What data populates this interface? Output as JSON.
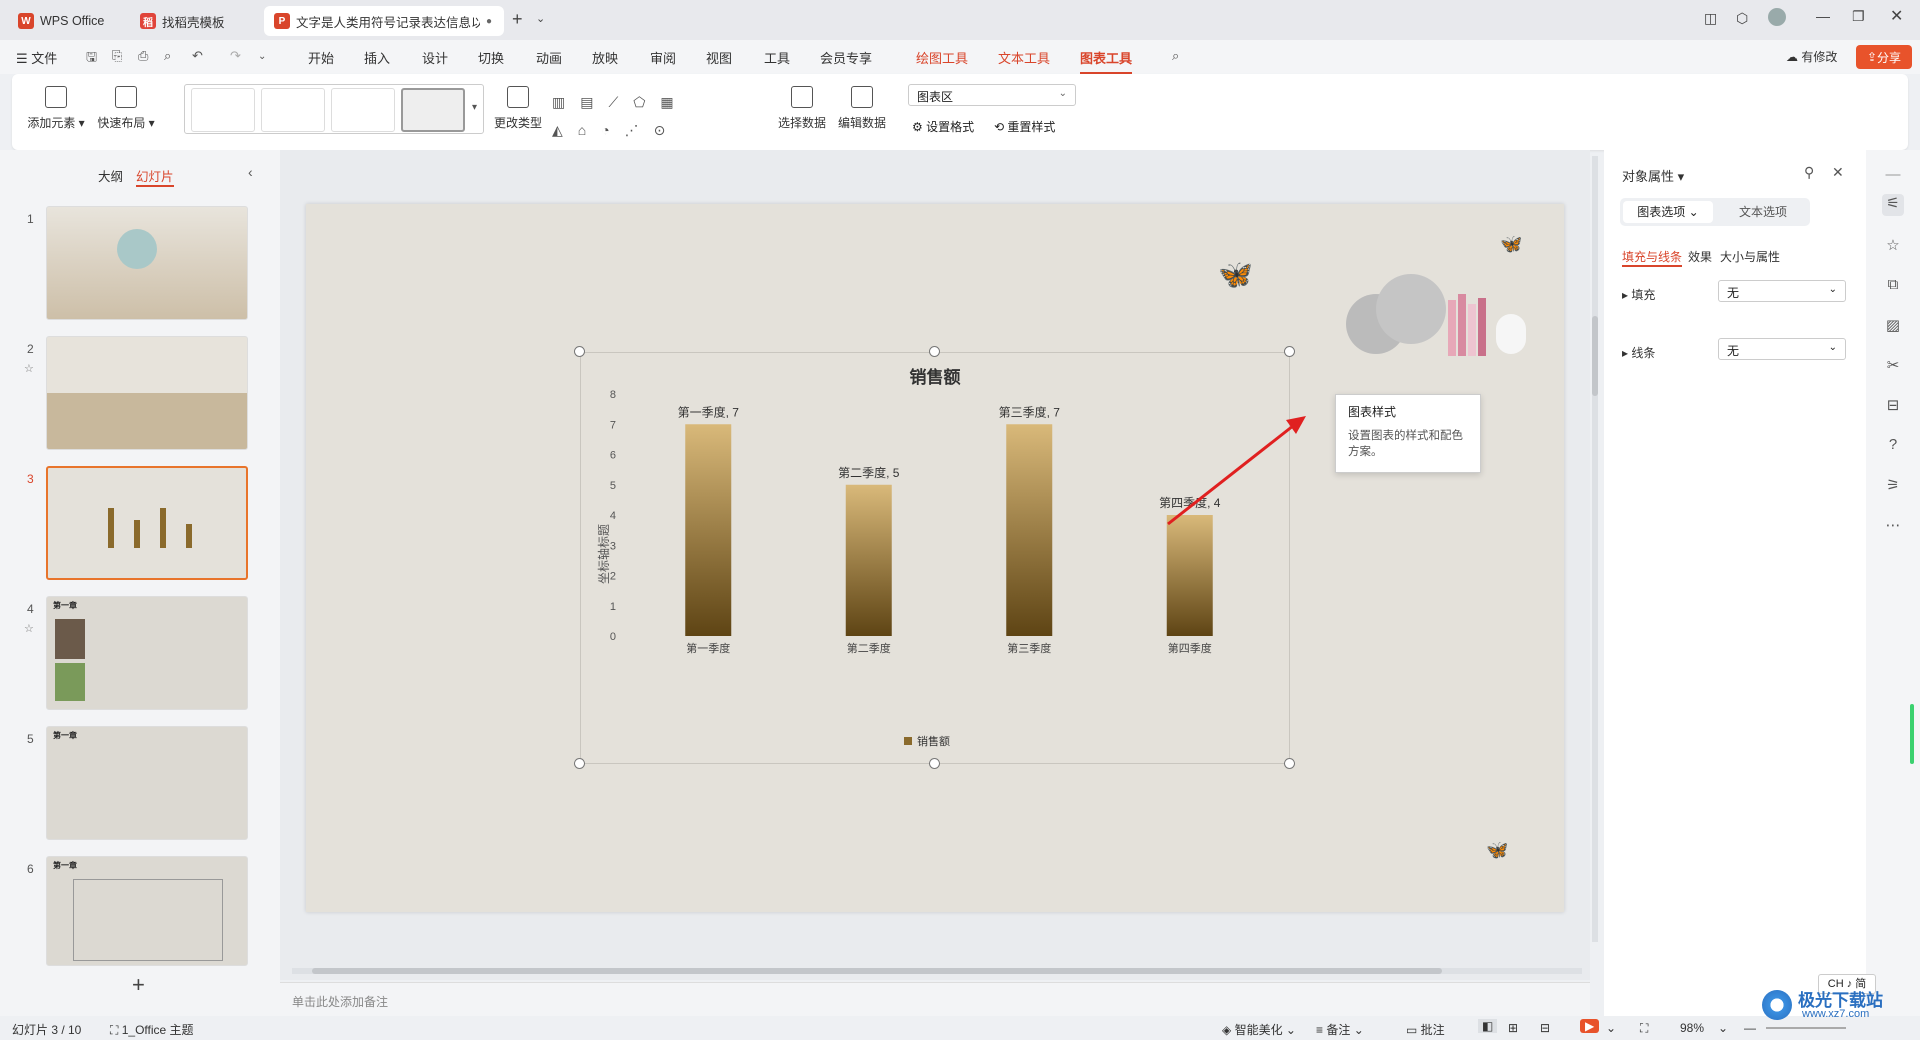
{
  "tabs": [
    {
      "label": "WPS Office",
      "logo": "W"
    },
    {
      "label": "找稻壳模板",
      "logo": "稻"
    },
    {
      "label": "文字是人类用符号记录表达信息以",
      "logo": "P"
    }
  ],
  "menu": {
    "file": "文件",
    "items": [
      "开始",
      "插入",
      "设计",
      "切换",
      "动画",
      "放映",
      "审阅",
      "视图",
      "工具",
      "会员专享"
    ],
    "context": [
      "绘图工具",
      "文本工具",
      "图表工具"
    ],
    "modified": "有修改",
    "share": "分享"
  },
  "ribbon": {
    "add_element": "添加元素",
    "quick_layout": "快速布局",
    "change_type": "更改类型",
    "select_data": "选择数据",
    "edit_data": "编辑数据",
    "chart_area": "图表区",
    "set_format": "设置格式",
    "reset_style": "重置样式"
  },
  "left": {
    "outline": "大纲",
    "slides": "幻灯片",
    "slide_numbers": [
      "1",
      "2",
      "3",
      "4",
      "5",
      "6"
    ],
    "thumb_title": "第一章"
  },
  "chart_data": {
    "type": "bar",
    "title": "销售额",
    "categories": [
      "第一季度",
      "第二季度",
      "第三季度",
      "第四季度"
    ],
    "values": [
      7,
      5,
      7,
      4
    ],
    "data_labels": [
      "第一季度, 7",
      "第二季度, 5",
      "第三季度, 7",
      "第四季度, 4"
    ],
    "ylabel": "坐标轴标题",
    "ylim": [
      0,
      8
    ],
    "yticks": [
      "0",
      "1",
      "2",
      "3",
      "4",
      "5",
      "6",
      "7",
      "8"
    ],
    "legend": "销售额",
    "legend_position": "bottom",
    "bar_color_top": "#d9b97a",
    "bar_color_bottom": "#5e4414"
  },
  "tooltip": {
    "title": "图表样式",
    "text": "设置图表的样式和配色方案。"
  },
  "right": {
    "title": "对象属性",
    "tab1": "图表选项",
    "tab2": "文本选项",
    "subtabs": [
      "填充与线条",
      "效果",
      "大小与属性"
    ],
    "fill_label": "填充",
    "fill_value": "无",
    "line_label": "线条",
    "line_value": "无"
  },
  "notes_placeholder": "单击此处添加备注",
  "status": {
    "slide": "幻灯片 3 / 10",
    "theme": "1_Office 主题",
    "beautify": "智能美化",
    "notes": "备注",
    "comment": "批注",
    "zoom": "98%",
    "ime": "CH ♪ 简"
  },
  "watermark": {
    "name": "极光下载站",
    "url": "www.xz7.com"
  },
  "colors": {
    "accent": "#d9452b"
  }
}
